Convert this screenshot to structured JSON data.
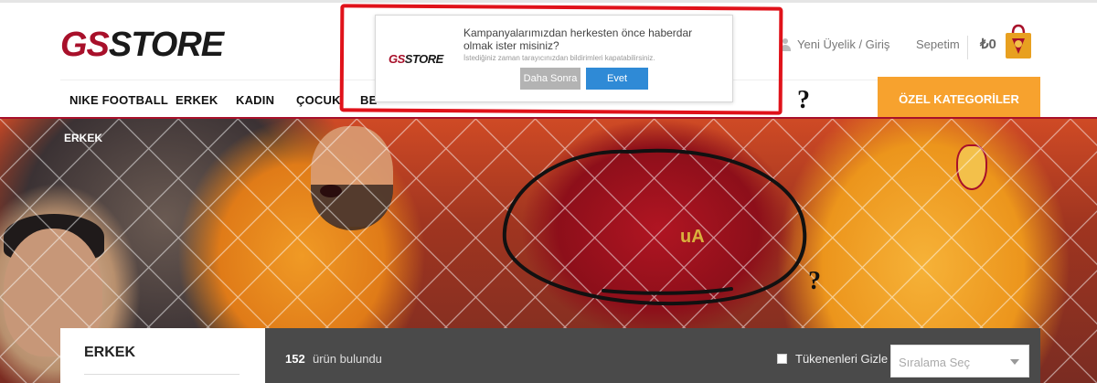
{
  "header": {
    "logo": {
      "gs": "GS",
      "store": "STORE"
    },
    "user_link": "Yeni Üyelik / Giriş",
    "cart_link": "Sepetim",
    "cart_amount": "₺0"
  },
  "nav": {
    "items": [
      {
        "label": "NIKE FOOTBALL"
      },
      {
        "label": "ERKEK"
      },
      {
        "label": "KADIN"
      },
      {
        "label": "ÇOCUK"
      },
      {
        "label": "BE"
      }
    ],
    "special_category": "ÖZEL KATEGORİLER"
  },
  "popup": {
    "logo": {
      "gs": "GS",
      "store": "STORE"
    },
    "title": "Kampanyalarımızdan herkesten önce haberdar olmak ister misiniz?",
    "subtitle": "İstediğiniz zaman tarayıcınızdan bildirimleri kapatabilirsiniz.",
    "later_button": "Daha Sonra",
    "yes_button": "Evet"
  },
  "hero": {
    "breadcrumb": "ERKEK",
    "jersey_text": "uA"
  },
  "annotations": {
    "question_mark": "?"
  },
  "listing": {
    "category_title": "ERKEK",
    "product_count": "152",
    "product_count_label": "ürün bulundu",
    "hide_out_of_stock": "Tükenenleri Gizle",
    "sort_placeholder": "Sıralama Seç"
  },
  "colors": {
    "brand_red": "#a8102a",
    "brand_yellow": "#f3a51c",
    "special_orange": "#f7a22e",
    "yes_blue": "#2f8ad6",
    "annotation_red": "#e0121a"
  }
}
